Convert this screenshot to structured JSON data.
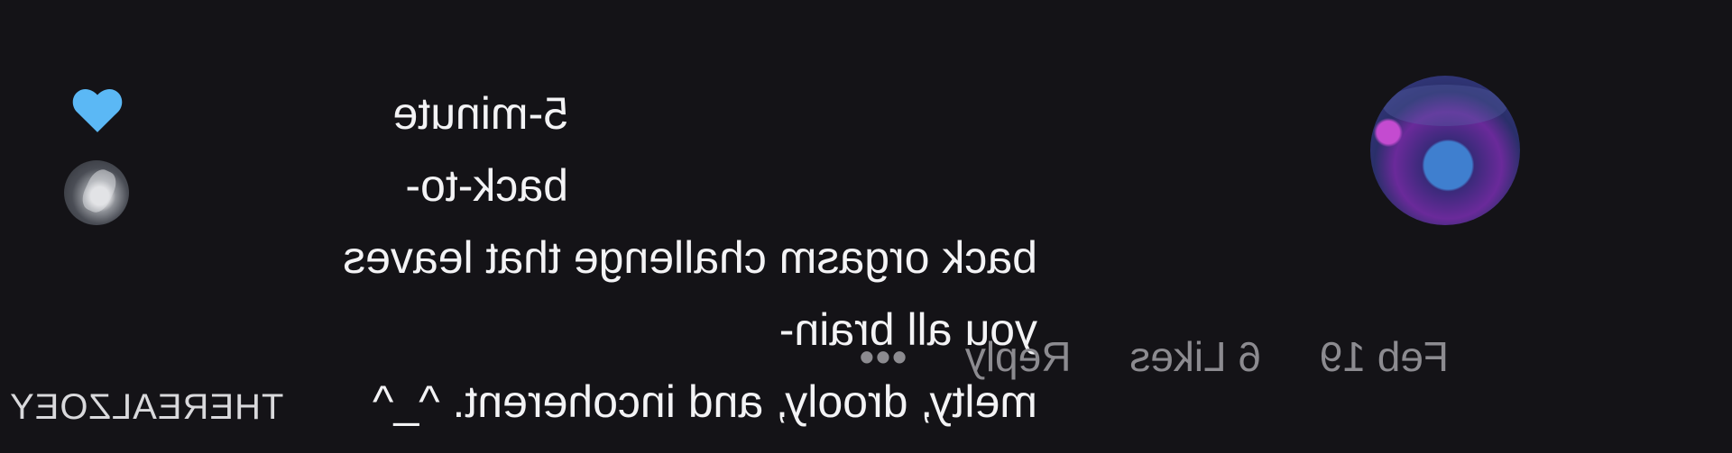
{
  "comment": {
    "username": "",
    "text_line1": "5-minute back-to-",
    "text_line2": "back orgasm challenge that leaves you all brain-",
    "text_line3": "melty, drooly, and incoherent. ^_^",
    "date": "Feb 19",
    "likes": "6 Likes",
    "reply_label": "Reply",
    "more_label": "•••",
    "avatar_icon": "user-avatar-icon",
    "liked_icon": "heart-icon",
    "creator_avatar_icon": "creator-avatar-icon"
  },
  "watermark": {
    "text": "THEREALZOEY"
  },
  "colors": {
    "background": "#141317",
    "text": "#f3f3f5",
    "meta_text": "#8c8b90",
    "heart": "#5bb8f5"
  }
}
